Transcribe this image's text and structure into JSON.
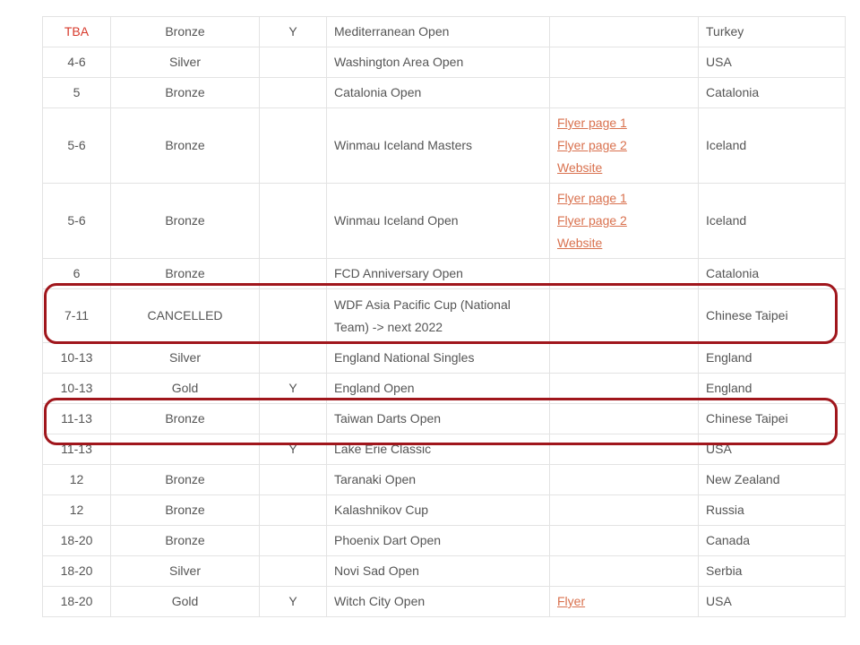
{
  "rows": [
    {
      "date": "TBA",
      "tier": "Bronze",
      "y": "Y",
      "event": "Mediterranean Open",
      "links": [],
      "country": "Turkey"
    },
    {
      "date": "4-6",
      "tier": "Silver",
      "y": "",
      "event": "Washington Area Open",
      "links": [],
      "country": "USA"
    },
    {
      "date": "5",
      "tier": "Bronze",
      "y": "",
      "event": "Catalonia Open",
      "links": [],
      "country": "Catalonia"
    },
    {
      "date": "5-6",
      "tier": "Bronze",
      "y": "",
      "event": "Winmau Iceland Masters",
      "links": [
        "Flyer page 1",
        "Flyer page 2",
        "Website"
      ],
      "country": "Iceland"
    },
    {
      "date": "5-6",
      "tier": "Bronze",
      "y": "",
      "event": "Winmau Iceland Open",
      "links": [
        "Flyer page 1",
        "Flyer page 2",
        "Website"
      ],
      "country": "Iceland"
    },
    {
      "date": "6",
      "tier": "Bronze",
      "y": "",
      "event": "FCD Anniversary Open",
      "links": [],
      "country": "Catalonia"
    },
    {
      "date": "7-11",
      "tier": "CANCELLED",
      "y": "",
      "event": "WDF Asia Pacific Cup (National Team) -> next 2022",
      "links": [],
      "country": "Chinese Taipei"
    },
    {
      "date": "10-13",
      "tier": "Silver",
      "y": "",
      "event": "England National Singles",
      "links": [],
      "country": "England"
    },
    {
      "date": "10-13",
      "tier": "Gold",
      "y": "Y",
      "event": "England Open",
      "links": [],
      "country": "England"
    },
    {
      "date": "11-13",
      "tier": "Bronze",
      "y": "",
      "event": "Taiwan Darts Open",
      "links": [],
      "country": "Chinese Taipei"
    },
    {
      "date": "11-13",
      "tier": "",
      "y": "Y",
      "event": "Lake Erie Classic",
      "links": [],
      "country": "USA"
    },
    {
      "date": "12",
      "tier": "Bronze",
      "y": "",
      "event": "Taranaki Open",
      "links": [],
      "country": "New Zealand"
    },
    {
      "date": "12",
      "tier": "Bronze",
      "y": "",
      "event": "Kalashnikov Cup",
      "links": [],
      "country": "Russia"
    },
    {
      "date": "18-20",
      "tier": "Bronze",
      "y": "",
      "event": "Phoenix Dart Open",
      "links": [],
      "country": "Canada"
    },
    {
      "date": "18-20",
      "tier": "Silver",
      "y": "",
      "event": "Novi Sad Open",
      "links": [],
      "country": "Serbia"
    },
    {
      "date": "18-20",
      "tier": "Gold",
      "y": "Y",
      "event": "Witch City Open",
      "links": [
        "Flyer"
      ],
      "country": "USA"
    }
  ],
  "colors": {
    "text": "#555555",
    "tba": "#d7392b",
    "link": "#d9714e",
    "highlight": "#a0161c",
    "border": "#e3e3e3"
  }
}
